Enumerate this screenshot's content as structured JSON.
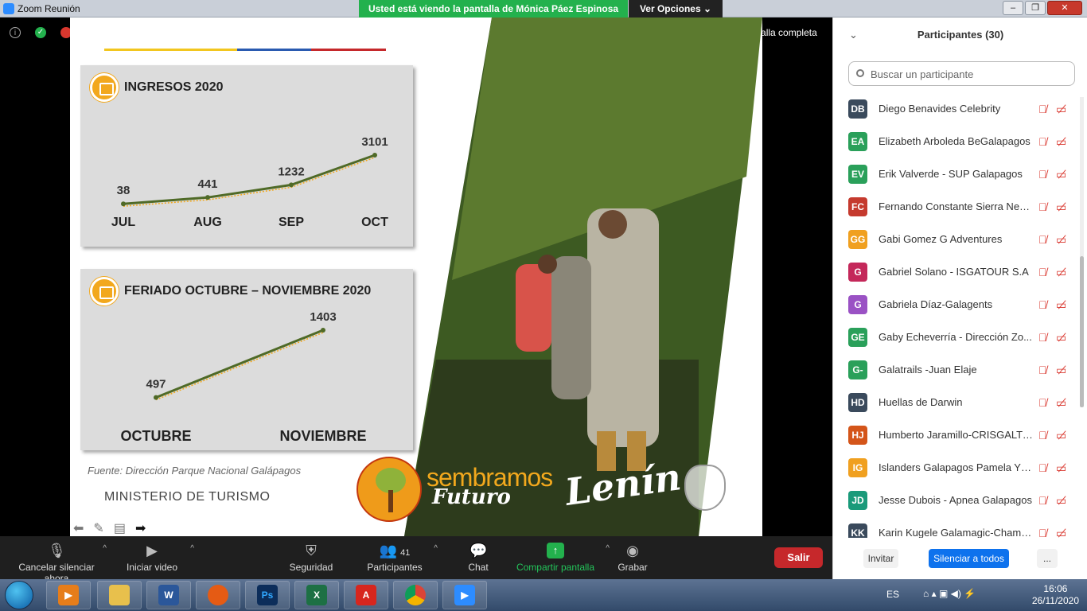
{
  "window": {
    "title": "Zoom Reunión",
    "share_banner": "Usted está viendo la pantalla de Mónica Páez Espinosa",
    "view_options": "Ver Opciones ⌄",
    "fullscreen_label": "Cambiar a pantalla completa"
  },
  "slide": {
    "card1": {
      "title": "INGRESOS 2020"
    },
    "card2": {
      "title": "FERIADO OCTUBRE – NOVIEMBRE 2020"
    },
    "source": "Fuente: Dirección Parque Nacional Galápagos",
    "ministry": "MINISTERIO DE TURISMO",
    "logo_text": "sembramos",
    "logo_sub": "Futuro",
    "signature": "Lenín"
  },
  "chart_data": [
    {
      "type": "line",
      "title": "INGRESOS 2020",
      "categories": [
        "JUL",
        "AUG",
        "SEP",
        "OCT"
      ],
      "values": [
        38,
        441,
        1232,
        3101
      ]
    },
    {
      "type": "line",
      "title": "FERIADO OCTUBRE – NOVIEMBRE 2020",
      "categories": [
        "OCTUBRE",
        "NOVIEMBRE"
      ],
      "values": [
        497,
        1403
      ]
    }
  ],
  "toolbar": {
    "mute_label": "Cancelar silenciar ahora",
    "video_label": "Iniciar video",
    "security_label": "Seguridad",
    "participants_label": "Participantes",
    "participants_count": "41",
    "chat_label": "Chat",
    "share_label": "Compartir pantalla",
    "record_label": "Grabar",
    "leave_label": "Salir"
  },
  "panel": {
    "title": "Participantes (30)",
    "search_placeholder": "Buscar un participante",
    "invite_label": "Invitar",
    "mute_all_label": "Silenciar a todos",
    "more_label": "...",
    "participants": [
      {
        "initials": "DB",
        "name": "Diego Benavides Celebrity",
        "color": "#3a4a5c"
      },
      {
        "initials": "EA",
        "name": "Elizabeth Arboleda BeGalapagos",
        "color": "#2aa05a"
      },
      {
        "initials": "EV",
        "name": "Erik Valverde - SUP Galapagos",
        "color": "#2aa05a"
      },
      {
        "initials": "FC",
        "name": "Fernando Constante Sierra Neg...",
        "color": "#c53a2e"
      },
      {
        "initials": "GG",
        "name": "Gabi Gomez G Adventures",
        "color": "#f0a020"
      },
      {
        "initials": "G",
        "name": "Gabriel Solano - ISGATOUR S.A",
        "color": "#c4285a"
      },
      {
        "initials": "G",
        "name": "Gabriela Díaz-Galagents",
        "color": "#9a52c4"
      },
      {
        "initials": "GE",
        "name": "Gaby Echeverría - Dirección Zo...",
        "color": "#2aa05a"
      },
      {
        "initials": "G-",
        "name": "Galatrails -Juan Elaje",
        "color": "#2aa05a"
      },
      {
        "initials": "HD",
        "name": "Huellas de Darwin",
        "color": "#3a4a5c"
      },
      {
        "initials": "HJ",
        "name": "Humberto Jaramillo-CRISGALTO...",
        "color": "#d4551a"
      },
      {
        "initials": "IG",
        "name": "Islanders Galapagos Pamela Yé...",
        "color": "#f0a020"
      },
      {
        "initials": "JD",
        "name": "Jesse Dubois - Apnea Galapagos",
        "color": "#1a9a7a"
      },
      {
        "initials": "KK",
        "name": "Karin Kugele Galamagic-Champ...",
        "color": "#3a4a5c"
      }
    ]
  },
  "taskbar": {
    "language": "ES",
    "time": "16:06",
    "date": "26/11/2020"
  }
}
